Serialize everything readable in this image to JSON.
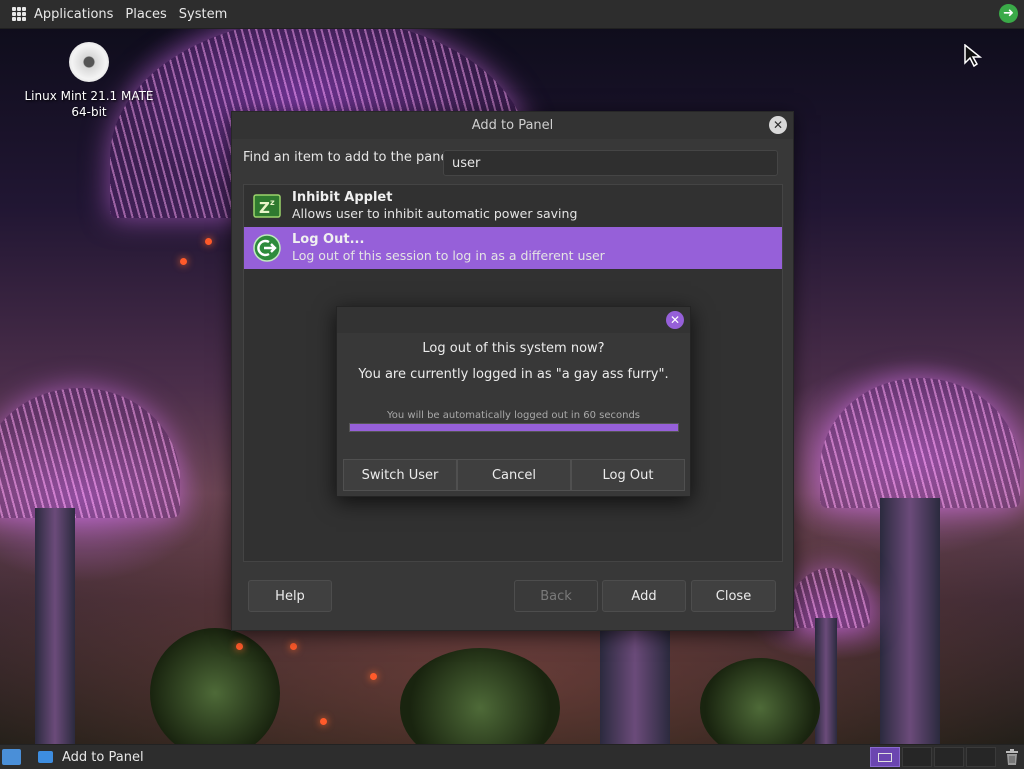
{
  "top_panel": {
    "menus": [
      "Applications",
      "Places",
      "System"
    ],
    "tray_icon": "logout-arrow-icon"
  },
  "desktop": {
    "icon_label_line1": "Linux Mint 21.1 MATE",
    "icon_label_line2": "64-bit",
    "icon": "disc-icon"
  },
  "add_to_panel": {
    "title": "Add to Panel",
    "find_label": "Find an item to add to the panel:",
    "search_value": "user",
    "items": [
      {
        "title": "Inhibit Applet",
        "description": "Allows user to inhibit automatic power saving",
        "icon": "inhibit-applet-icon",
        "selected": false
      },
      {
        "title": "Log Out...",
        "description": "Log out of this session to log in as a different user",
        "icon": "logout-icon",
        "selected": true
      }
    ],
    "buttons": {
      "help": "Help",
      "back": "Back",
      "add": "Add",
      "close": "Close"
    },
    "accent": "#9660d9"
  },
  "logout_dialog": {
    "heading": "Log out of this system now?",
    "message": "You are currently logged in as \"a gay ass furry\".",
    "countdown": "You will be automatically logged out in 60 seconds",
    "progress_fraction": 1.0,
    "buttons": {
      "switch_user": "Switch User",
      "cancel": "Cancel",
      "log_out": "Log Out"
    }
  },
  "bottom_panel": {
    "task_label": "Add to Panel",
    "workspaces": 4,
    "active_workspace": 1
  }
}
